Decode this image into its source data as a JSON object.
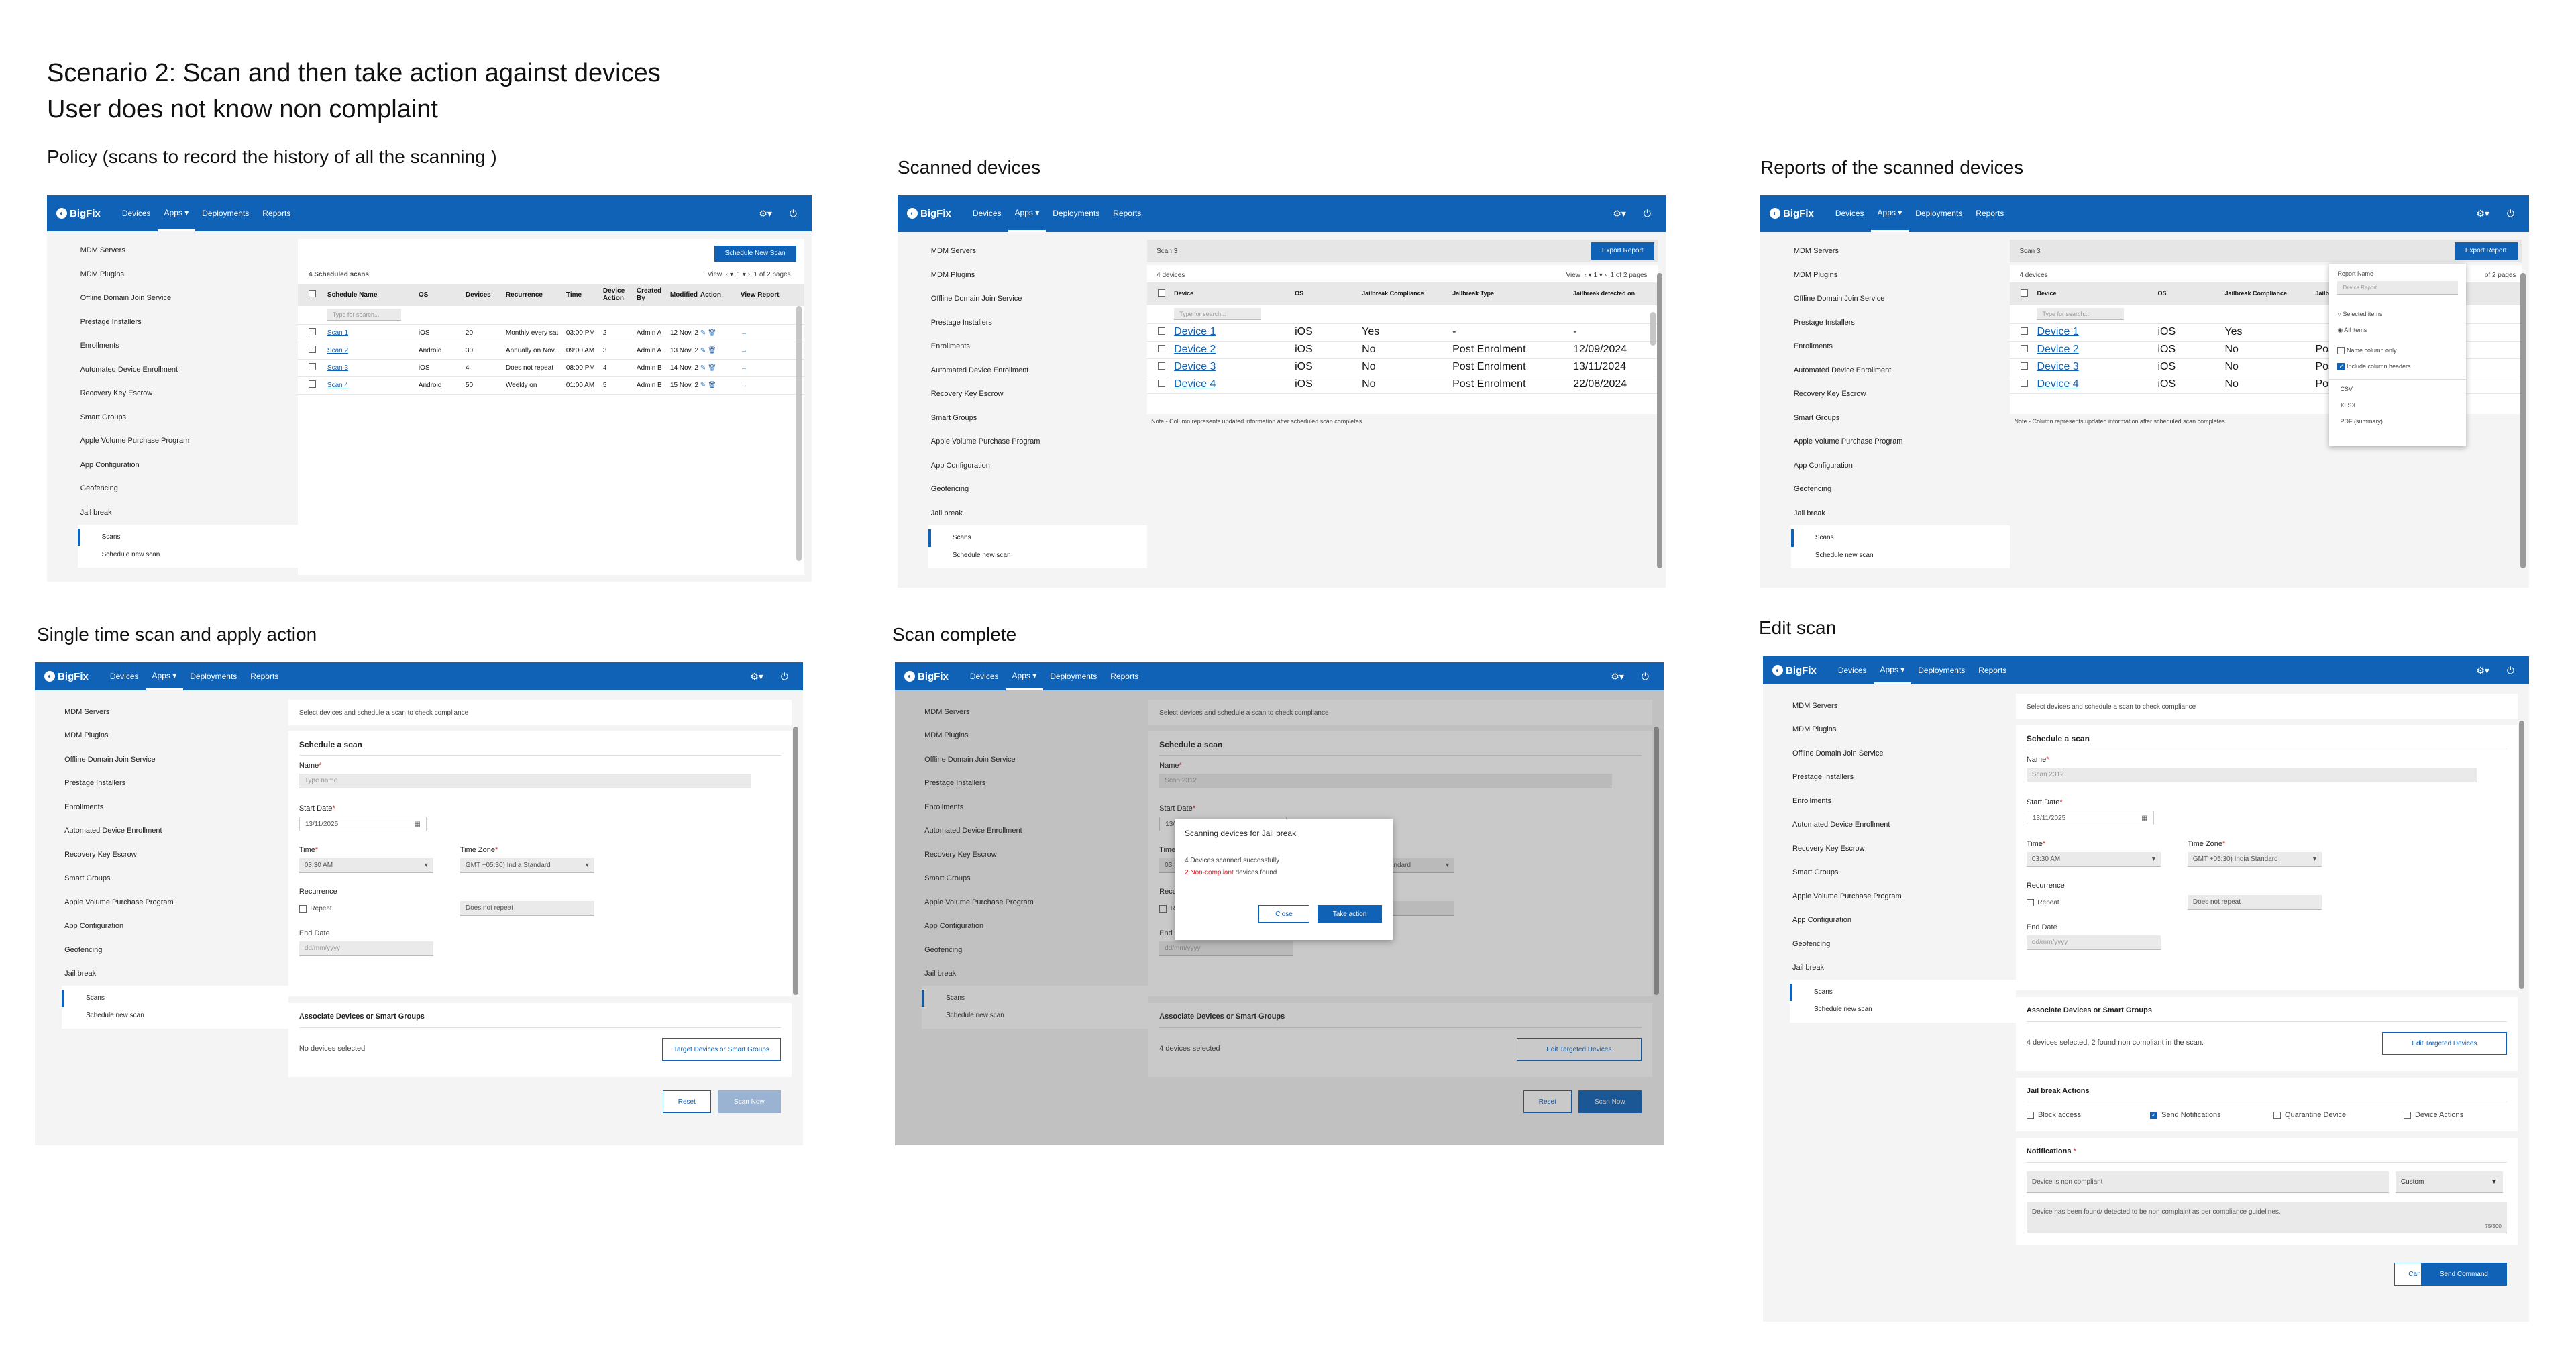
{
  "title_line1": "Scenario 2: Scan and then take action against devices",
  "title_line2": "User does not know non complaint",
  "panel_titles": {
    "p1": "Policy (scans to record the history of all the scanning )",
    "p2": "Scanned devices",
    "p3": "Reports of the scanned devices",
    "p4": "Single time scan and apply action",
    "p5": "Scan complete",
    "p6": "Edit scan"
  },
  "nav": {
    "brand": "BigFix",
    "devices": "Devices",
    "apps": "Apps",
    "deployments": "Deployments",
    "reports": "Reports"
  },
  "sidebar": [
    "MDM Servers",
    "MDM Plugins",
    "Offline Domain Join Service",
    "Prestage Installers",
    "Enrollments",
    "Automated Device Enrollment",
    "Recovery Key Escrow",
    "Smart Groups",
    "Apple Volume Purchase Program",
    "App Configuration",
    "Geofencing",
    "Jail break"
  ],
  "sidebar_sub": [
    "Scans",
    "Schedule new scan"
  ],
  "p1": {
    "button": "Schedule New Scan",
    "count": "4 Scheduled scans",
    "view": "View",
    "page": "1",
    "pages": "1 of 2 pages",
    "cols": [
      "Schedule Name",
      "OS",
      "Devices",
      "Recurrence",
      "Time",
      "Device Action",
      "Created By",
      "Modified",
      "Action",
      "View Report"
    ],
    "filter": "Type for search...",
    "rows": [
      [
        "Scan 1",
        "iOS",
        "20",
        "Monthly every sat",
        "03:00 PM",
        "2",
        "Admin A",
        "12 Nov, 2"
      ],
      [
        "Scan 2",
        "Android",
        "30",
        "Annually on Nov...",
        "09:00 AM",
        "3",
        "Admin A",
        "13 Nov, 2"
      ],
      [
        "Scan 3",
        "iOS",
        "4",
        "Does not repeat",
        "08:00 PM",
        "4",
        "Admin B",
        "14 Nov, 2"
      ],
      [
        "Scan 4",
        "Android",
        "50",
        "Weekly on",
        "01:00 AM",
        "5",
        "Admin B",
        "15 Nov, 2"
      ]
    ]
  },
  "p2": {
    "scan": "Scan 3",
    "button": "Export Report",
    "count": "4 devices",
    "view": "View",
    "page": "1",
    "pages": "1 of 2 pages",
    "cols": [
      "Device",
      "OS",
      "Jailbreak Compliance",
      "Jailbreak Type",
      "Jailbreak detected on"
    ],
    "filter": "Type for search...",
    "rows": [
      [
        "Device 1",
        "iOS",
        "Yes",
        "-",
        "-"
      ],
      [
        "Device 2",
        "iOS",
        "No",
        "Post Enrolment",
        "12/09/2024"
      ],
      [
        "Device 3",
        "iOS",
        "No",
        "Post Enrolment",
        "13/11/2024"
      ],
      [
        "Device 4",
        "iOS",
        "No",
        "Post Enrolment",
        "22/08/2024"
      ]
    ],
    "note": "Note - Column represents updated information after scheduled scan completes."
  },
  "p3": {
    "scan": "Scan 3",
    "button": "Export Report",
    "count": "4 devices",
    "pages": "of 2 pages",
    "cols": [
      "Device",
      "OS",
      "Jailbreak Compliance",
      "Jailbreak Type"
    ],
    "filter": "Type for search...",
    "rows": [
      [
        "Device 1",
        "iOS",
        "Yes",
        ""
      ],
      [
        "Device 2",
        "iOS",
        "No",
        "Post E"
      ],
      [
        "Device 3",
        "iOS",
        "No",
        "Post E"
      ],
      [
        "Device 4",
        "iOS",
        "No",
        "Post E"
      ]
    ],
    "note": "Note - Column represents updated information after scheduled scan completes.",
    "menu": {
      "label": "Report Name",
      "placeholder": "Device Report",
      "opt1": "Selected items",
      "opt2": "All items",
      "chk1": "Name column only",
      "chk2": "Include column headers",
      "f1": "CSV",
      "f2": "XLSX",
      "f3": "PDF (summary)"
    }
  },
  "form": {
    "hint": "Select devices and schedule a scan to check compliance",
    "heading": "Schedule a scan",
    "name": "Name",
    "name_ph": "Type name",
    "start": "Start Date",
    "date": "13/11/2025",
    "time": "Time",
    "time_v": "03:30 AM",
    "tz": "Time Zone",
    "tz_v": "GMT +05:30) India Standard",
    "rec": "Recurrence",
    "repeat": "Repeat",
    "no_rep": "Does not repeat",
    "end": "End Date",
    "end_ph": "dd/mm/yyyy",
    "assoc": "Associate Devices or Smart Groups",
    "reset": "Reset",
    "scan_now": "Scan Now"
  },
  "p4": {
    "none": "No devices selected",
    "target": "Target Devices or Smart Groups"
  },
  "p5": {
    "name_v": "Scan 2312",
    "selected": "4 devices selected",
    "edit": "Edit  Targeted Devices",
    "dialog_title": "Scanning devices for Jail break",
    "ok": "4 Devices scanned successfully",
    "bad_n": "2",
    "bad": "Non-compliant",
    "bad_tail": " devices found",
    "close": "Close",
    "take": "Take action"
  },
  "p6": {
    "selected": "4 devices selected, 2 found non compliant in the scan.",
    "edit": "Edit  Targeted Devices",
    "actions": "Jail break Actions",
    "a1": "Block access",
    "a2": "Send Notifications",
    "a3": "Quarantine Device",
    "a4": "Device Actions",
    "notif": "Notifications",
    "n_title": "Device is non compliant",
    "custom": "Custom",
    "n_body": "Device has been found/ detected to be non complaint as per compliance guidelines.",
    "counter": "75/500",
    "cancel": "Cancel",
    "send": "Send Command"
  },
  "colors": {
    "brand": "#0f62b6",
    "danger": "#da1e28"
  }
}
